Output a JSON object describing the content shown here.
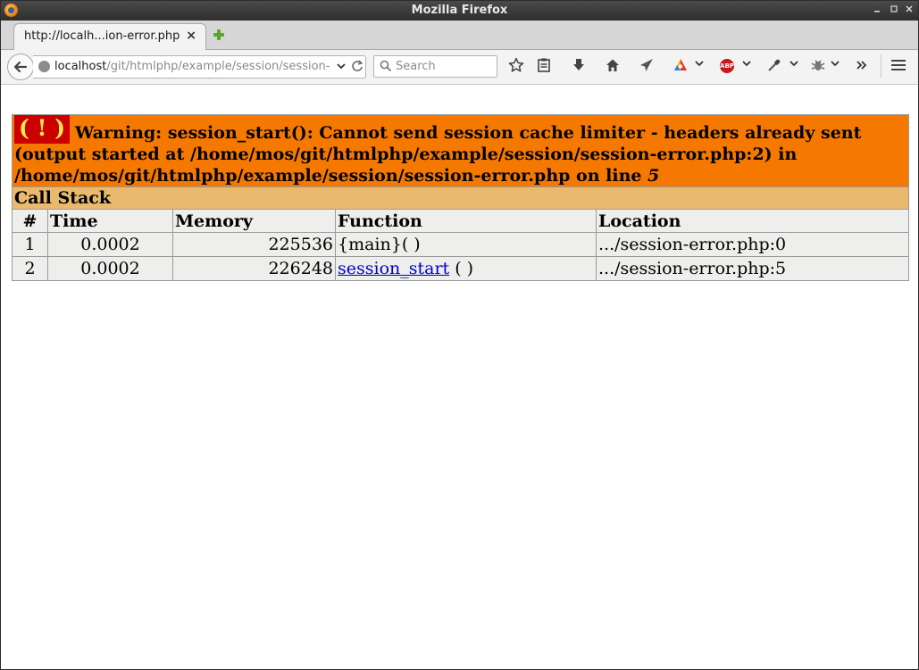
{
  "window": {
    "title": "Mozilla Firefox",
    "controls": {
      "minimize": "▫",
      "maximize": "▫",
      "close": "✕"
    }
  },
  "tab": {
    "title": "http://localh...ion-error.php",
    "close": "×"
  },
  "navbar": {
    "url_host": "localhost",
    "url_path": "/git/htmlphp/example/session/session-",
    "search_placeholder": "Search"
  },
  "icons": {
    "back": "back-arrow-icon",
    "bookmark": "star-icon",
    "reading_list": "clipboard-icon",
    "downloads": "download-arrow-icon",
    "home": "home-icon",
    "send": "paper-plane-icon",
    "extension_colorful": "colorful-triangle-icon",
    "adblock": "abp-icon",
    "dropper": "eyedropper-icon",
    "devtool": "bug-icon",
    "overflow": "double-chevron-icon",
    "menu": "hamburger-icon"
  },
  "error": {
    "bang": "( ! )",
    "message": "Warning: session_start(): Cannot send session cache limiter - headers already sent (output started at /home/mos/git/htmlphp/example/session/session-error.php:2) in /home/mos/git/htmlphp/example/session/session-error.php on line ",
    "line": "5",
    "call_stack_label": "Call Stack",
    "columns": [
      "#",
      "Time",
      "Memory",
      "Function",
      "Location"
    ],
    "rows": [
      {
        "num": "1",
        "time": "0.0002",
        "memory": "225536",
        "function": "{main}( )",
        "function_link": "",
        "function_suffix": "",
        "location": ".../session-error.php:0"
      },
      {
        "num": "2",
        "time": "0.0002",
        "memory": "226248",
        "function": "",
        "function_link": "session_start",
        "function_suffix": " ( )",
        "location": ".../session-error.php:5"
      }
    ]
  },
  "colors": {
    "warning_bg": "#f57900",
    "bang_bg": "#cc0000",
    "bang_fg": "#fce94f",
    "stack_header_bg": "#e9b96e",
    "cell_bg": "#eeeeec",
    "link": "#0000cc"
  }
}
